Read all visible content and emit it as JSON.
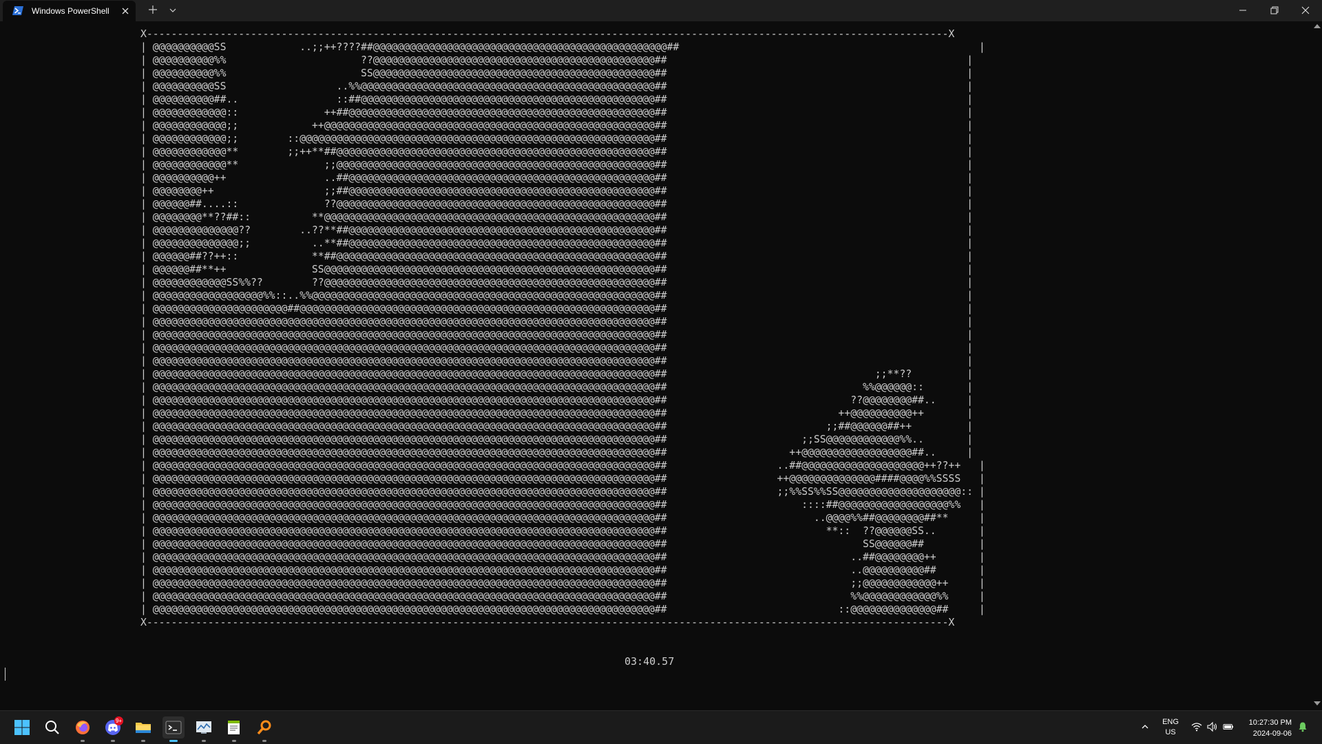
{
  "window": {
    "tab_title": "Windows PowerShell",
    "colors": {
      "titlebar": "#1f1f1f",
      "terminal_bg": "#0c0c0c",
      "terminal_fg": "#cccccc",
      "accent": "#4cc2ff"
    }
  },
  "terminal": {
    "ascii_lines": [
      "X-----------------------------------------------------------------------------------------------------------------------------------X",
      "| @@@@@@@@@@SS            ..;;++????##@@@@@@@@@@@@@@@@@@@@@@@@@@@@@@@@@@@@@@@@@@@@@@@@##                                                 |",
      "| @@@@@@@@@@%%                      ??@@@@@@@@@@@@@@@@@@@@@@@@@@@@@@@@@@@@@@@@@@@@@@##                                                 |",
      "| @@@@@@@@@@%%                      SS@@@@@@@@@@@@@@@@@@@@@@@@@@@@@@@@@@@@@@@@@@@@@@##                                                 |",
      "| @@@@@@@@@@SS                  ..%%@@@@@@@@@@@@@@@@@@@@@@@@@@@@@@@@@@@@@@@@@@@@@@@@##                                                 |",
      "| @@@@@@@@@@##..                ::##@@@@@@@@@@@@@@@@@@@@@@@@@@@@@@@@@@@@@@@@@@@@@@@@##                                                 |",
      "| @@@@@@@@@@@@::              ++##@@@@@@@@@@@@@@@@@@@@@@@@@@@@@@@@@@@@@@@@@@@@@@@@@@##                                                 |",
      "| @@@@@@@@@@@@;;            ++@@@@@@@@@@@@@@@@@@@@@@@@@@@@@@@@@@@@@@@@@@@@@@@@@@@@@@##                                                 |",
      "| @@@@@@@@@@@@;;        ::@@@@@@@@@@@@@@@@@@@@@@@@@@@@@@@@@@@@@@@@@@@@@@@@@@@@@@@@@@##                                                 |",
      "| @@@@@@@@@@@@**        ;;++**##@@@@@@@@@@@@@@@@@@@@@@@@@@@@@@@@@@@@@@@@@@@@@@@@@@@@##                                                 |",
      "| @@@@@@@@@@@@**              ;;@@@@@@@@@@@@@@@@@@@@@@@@@@@@@@@@@@@@@@@@@@@@@@@@@@@@##                                                 |",
      "| @@@@@@@@@@++                ..##@@@@@@@@@@@@@@@@@@@@@@@@@@@@@@@@@@@@@@@@@@@@@@@@@@##                                                 |",
      "| @@@@@@@@++                  ;;##@@@@@@@@@@@@@@@@@@@@@@@@@@@@@@@@@@@@@@@@@@@@@@@@@@##                                                 |",
      "| @@@@@@##....::              ??@@@@@@@@@@@@@@@@@@@@@@@@@@@@@@@@@@@@@@@@@@@@@@@@@@@@##                                                 |",
      "| @@@@@@@@**??##::          **@@@@@@@@@@@@@@@@@@@@@@@@@@@@@@@@@@@@@@@@@@@@@@@@@@@@@@##                                                 |",
      "| @@@@@@@@@@@@@@??        ..??**##@@@@@@@@@@@@@@@@@@@@@@@@@@@@@@@@@@@@@@@@@@@@@@@@@@##                                                 |",
      "| @@@@@@@@@@@@@@;;          ..**##@@@@@@@@@@@@@@@@@@@@@@@@@@@@@@@@@@@@@@@@@@@@@@@@@@##                                                 |",
      "| @@@@@@##??++::            **##@@@@@@@@@@@@@@@@@@@@@@@@@@@@@@@@@@@@@@@@@@@@@@@@@@@@##                                                 |",
      "| @@@@@@##**++              SS@@@@@@@@@@@@@@@@@@@@@@@@@@@@@@@@@@@@@@@@@@@@@@@@@@@@@@##                                                 |",
      "| @@@@@@@@@@@@SS%%??        ??@@@@@@@@@@@@@@@@@@@@@@@@@@@@@@@@@@@@@@@@@@@@@@@@@@@@@@##                                                 |",
      "| @@@@@@@@@@@@@@@@@@%%::..%%@@@@@@@@@@@@@@@@@@@@@@@@@@@@@@@@@@@@@@@@@@@@@@@@@@@@@@@@##                                                 |",
      "| @@@@@@@@@@@@@@@@@@@@@@##@@@@@@@@@@@@@@@@@@@@@@@@@@@@@@@@@@@@@@@@@@@@@@@@@@@@@@@@@@##                                                 |",
      "| @@@@@@@@@@@@@@@@@@@@@@@@@@@@@@@@@@@@@@@@@@@@@@@@@@@@@@@@@@@@@@@@@@@@@@@@@@@@@@@@@@##                                                 |",
      "| @@@@@@@@@@@@@@@@@@@@@@@@@@@@@@@@@@@@@@@@@@@@@@@@@@@@@@@@@@@@@@@@@@@@@@@@@@@@@@@@@@##                                                 |",
      "| @@@@@@@@@@@@@@@@@@@@@@@@@@@@@@@@@@@@@@@@@@@@@@@@@@@@@@@@@@@@@@@@@@@@@@@@@@@@@@@@@@##                                                 |",
      "| @@@@@@@@@@@@@@@@@@@@@@@@@@@@@@@@@@@@@@@@@@@@@@@@@@@@@@@@@@@@@@@@@@@@@@@@@@@@@@@@@@##                                                 |",
      "| @@@@@@@@@@@@@@@@@@@@@@@@@@@@@@@@@@@@@@@@@@@@@@@@@@@@@@@@@@@@@@@@@@@@@@@@@@@@@@@@@@##                                  ;;**??         |",
      "| @@@@@@@@@@@@@@@@@@@@@@@@@@@@@@@@@@@@@@@@@@@@@@@@@@@@@@@@@@@@@@@@@@@@@@@@@@@@@@@@@@##                                %%@@@@@@::       |",
      "| @@@@@@@@@@@@@@@@@@@@@@@@@@@@@@@@@@@@@@@@@@@@@@@@@@@@@@@@@@@@@@@@@@@@@@@@@@@@@@@@@@##                              ??@@@@@@@@##..     |",
      "| @@@@@@@@@@@@@@@@@@@@@@@@@@@@@@@@@@@@@@@@@@@@@@@@@@@@@@@@@@@@@@@@@@@@@@@@@@@@@@@@@@##                            ++@@@@@@@@@@++       |",
      "| @@@@@@@@@@@@@@@@@@@@@@@@@@@@@@@@@@@@@@@@@@@@@@@@@@@@@@@@@@@@@@@@@@@@@@@@@@@@@@@@@@##                          ;;##@@@@@@##++         |",
      "| @@@@@@@@@@@@@@@@@@@@@@@@@@@@@@@@@@@@@@@@@@@@@@@@@@@@@@@@@@@@@@@@@@@@@@@@@@@@@@@@@@##                      ;;SS@@@@@@@@@@@@%%..       |",
      "| @@@@@@@@@@@@@@@@@@@@@@@@@@@@@@@@@@@@@@@@@@@@@@@@@@@@@@@@@@@@@@@@@@@@@@@@@@@@@@@@@@##                    ++@@@@@@@@@@@@@@@@@@##..     |",
      "| @@@@@@@@@@@@@@@@@@@@@@@@@@@@@@@@@@@@@@@@@@@@@@@@@@@@@@@@@@@@@@@@@@@@@@@@@@@@@@@@@@##                  ..##@@@@@@@@@@@@@@@@@@@@++??++   |",
      "| @@@@@@@@@@@@@@@@@@@@@@@@@@@@@@@@@@@@@@@@@@@@@@@@@@@@@@@@@@@@@@@@@@@@@@@@@@@@@@@@@@##                  ++@@@@@@@@@@@@@@####@@@@%%SSSS   |",
      "| @@@@@@@@@@@@@@@@@@@@@@@@@@@@@@@@@@@@@@@@@@@@@@@@@@@@@@@@@@@@@@@@@@@@@@@@@@@@@@@@@@##                  ;;%%SS%%SS@@@@@@@@@@@@@@@@@@@@:: |",
      "| @@@@@@@@@@@@@@@@@@@@@@@@@@@@@@@@@@@@@@@@@@@@@@@@@@@@@@@@@@@@@@@@@@@@@@@@@@@@@@@@@@##                      ::::##@@@@@@@@@@@@@@@@@@%%   |",
      "| @@@@@@@@@@@@@@@@@@@@@@@@@@@@@@@@@@@@@@@@@@@@@@@@@@@@@@@@@@@@@@@@@@@@@@@@@@@@@@@@@@##                        ..@@@@%%##@@@@@@@@##**     |",
      "| @@@@@@@@@@@@@@@@@@@@@@@@@@@@@@@@@@@@@@@@@@@@@@@@@@@@@@@@@@@@@@@@@@@@@@@@@@@@@@@@@@##                          **::  ??@@@@@@SS..       |",
      "| @@@@@@@@@@@@@@@@@@@@@@@@@@@@@@@@@@@@@@@@@@@@@@@@@@@@@@@@@@@@@@@@@@@@@@@@@@@@@@@@@@##                                SS@@@@@@##         |",
      "| @@@@@@@@@@@@@@@@@@@@@@@@@@@@@@@@@@@@@@@@@@@@@@@@@@@@@@@@@@@@@@@@@@@@@@@@@@@@@@@@@@##                              ..##@@@@@@@@++       |",
      "| @@@@@@@@@@@@@@@@@@@@@@@@@@@@@@@@@@@@@@@@@@@@@@@@@@@@@@@@@@@@@@@@@@@@@@@@@@@@@@@@@@##                              ..@@@@@@@@@@##       |",
      "| @@@@@@@@@@@@@@@@@@@@@@@@@@@@@@@@@@@@@@@@@@@@@@@@@@@@@@@@@@@@@@@@@@@@@@@@@@@@@@@@@@##                              ;;@@@@@@@@@@@@++     |",
      "| @@@@@@@@@@@@@@@@@@@@@@@@@@@@@@@@@@@@@@@@@@@@@@@@@@@@@@@@@@@@@@@@@@@@@@@@@@@@@@@@@@##                              %%@@@@@@@@@@@@%%     |",
      "| @@@@@@@@@@@@@@@@@@@@@@@@@@@@@@@@@@@@@@@@@@@@@@@@@@@@@@@@@@@@@@@@@@@@@@@@@@@@@@@@@@##                            ::@@@@@@@@@@@@@@##     |",
      "X-----------------------------------------------------------------------------------------------------------------------------------X"
    ],
    "timer": "03:40.57"
  },
  "taskbar": {
    "apps": [
      {
        "name": "start",
        "icon": "windows-logo-icon"
      },
      {
        "name": "search",
        "icon": "search-icon"
      },
      {
        "name": "firefox",
        "icon": "firefox-icon"
      },
      {
        "name": "discord",
        "icon": "discord-icon",
        "badge": "9+"
      },
      {
        "name": "file-explorer",
        "icon": "folder-icon"
      },
      {
        "name": "terminal",
        "icon": "terminal-icon",
        "active": true
      },
      {
        "name": "resource-monitor",
        "icon": "monitor-chart-icon"
      },
      {
        "name": "notepad",
        "icon": "notepad-icon"
      },
      {
        "name": "search-tool",
        "icon": "magnifier-orange-icon"
      }
    ],
    "tray": {
      "lang_primary": "ENG",
      "lang_secondary": "US",
      "time": "10:27:30 PM",
      "date": "2024-09-06"
    }
  }
}
